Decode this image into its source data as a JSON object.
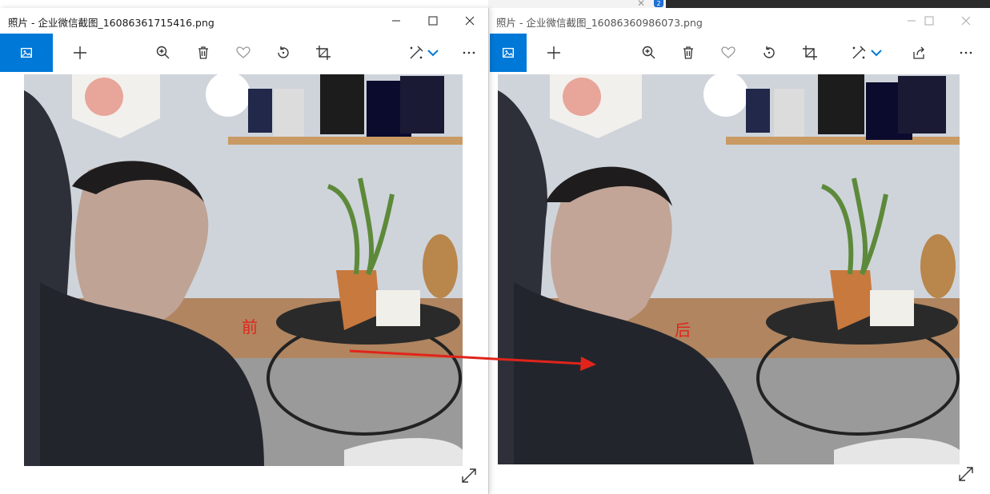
{
  "background": {
    "badge": "2",
    "close_glyph": "✕"
  },
  "windows": [
    {
      "title": "照片 - 企业微信截图_16086361715416.png",
      "label": "前",
      "toolbar": [
        "photo-icon",
        "add-icon",
        "zoom-in-icon",
        "delete-icon",
        "favorite-icon",
        "rotate-icon",
        "crop-icon",
        "edit-icon",
        "chevron-down-icon",
        "more-icon"
      ]
    },
    {
      "title": "照片 - 企业微信截图_16086360986073.png",
      "label": "后",
      "toolbar": [
        "photo-icon",
        "add-icon",
        "zoom-in-icon",
        "delete-icon",
        "favorite-icon",
        "rotate-icon",
        "crop-icon",
        "edit-icon",
        "chevron-down-icon",
        "share-icon",
        "more-icon"
      ]
    }
  ],
  "colors": {
    "accent": "#0078d7",
    "annotation": "#e0241b"
  }
}
